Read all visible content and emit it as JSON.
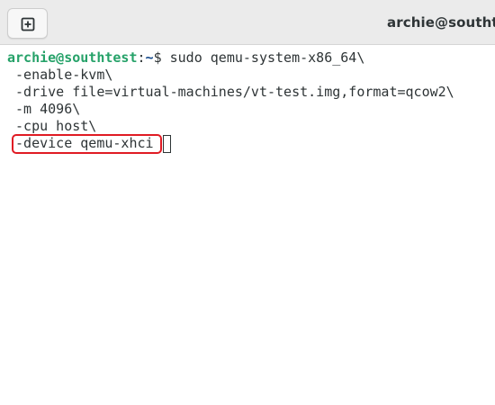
{
  "window": {
    "title": "archie@southtest"
  },
  "toolbar": {
    "new_tab_icon": "new-tab-icon"
  },
  "terminal": {
    "prompt": {
      "user_host": "archie@southtest",
      "separator": ":",
      "path": "~",
      "symbol": "$ "
    },
    "command": "sudo qemu-system-x86_64\\",
    "continuation_lines": [
      " -enable-kvm\\",
      " -drive file=virtual-machines/vt-test.img,format=qcow2\\",
      " -m 4096\\",
      " -cpu host\\",
      " -device qemu-xhci"
    ]
  },
  "colors": {
    "prompt_user": "#26a269",
    "prompt_path": "#12488b",
    "text": "#2e3436",
    "highlight": "#e01b24",
    "titlebar": "#ebebeb"
  }
}
